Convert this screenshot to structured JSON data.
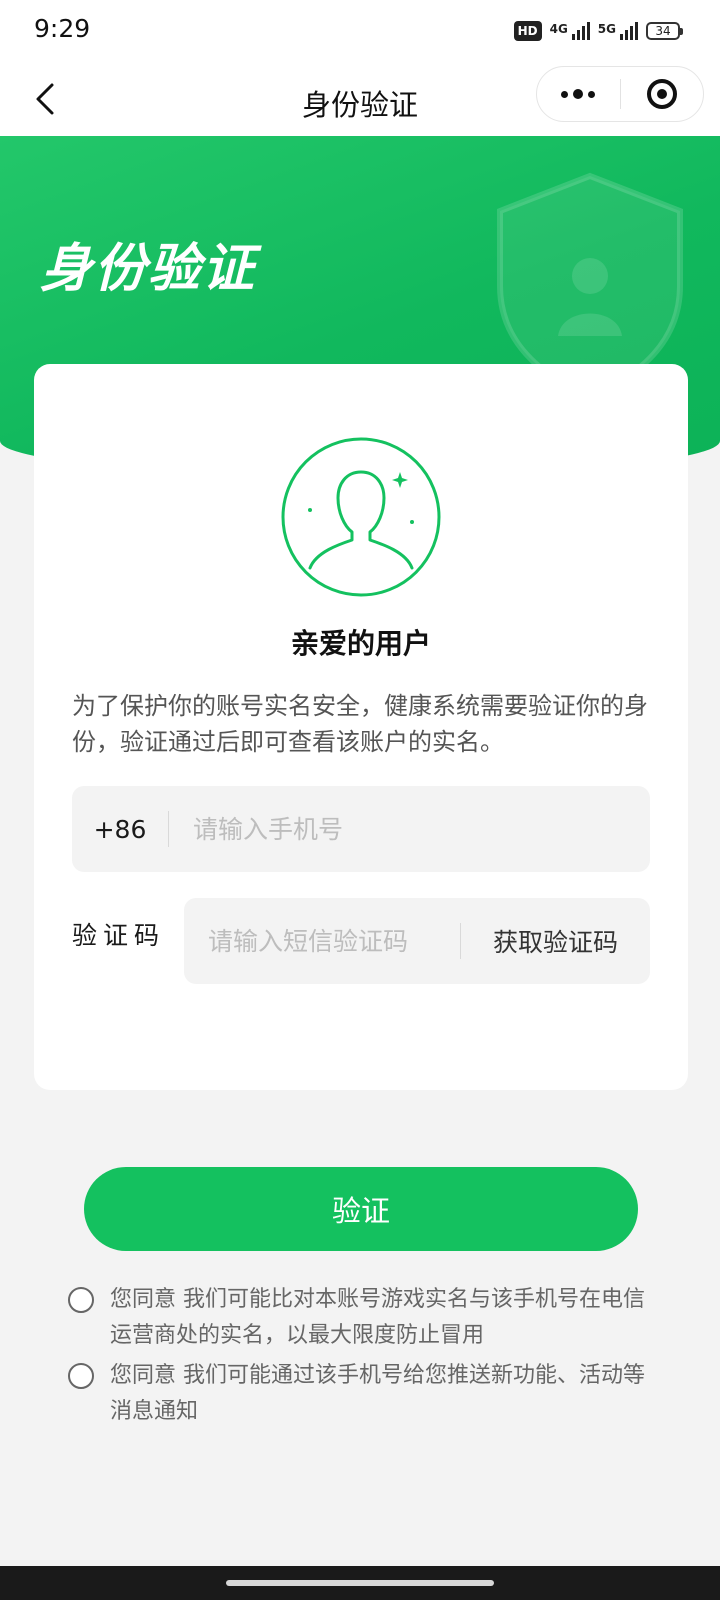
{
  "status_bar": {
    "time": "9:29",
    "hd_badge": "HD",
    "network_1": "4G",
    "network_2": "5G",
    "battery_level": "34"
  },
  "nav": {
    "title": "身份验证",
    "back_icon": "chevron-left-icon",
    "more_icon": "more-dots-icon",
    "close_icon": "target-close-icon"
  },
  "hero": {
    "title": "身份验证",
    "decoration_icon": "shield-user-icon"
  },
  "card": {
    "avatar_icon": "user-avatar-icon",
    "greeting": "亲爱的用户",
    "description": "为了保护你的账号实名安全，健康系统需要验证你的身份，验证通过后即可查看该账户的实名。",
    "phone": {
      "country_code": "+86",
      "placeholder": "请输入手机号",
      "value": ""
    },
    "code": {
      "label": "验证码",
      "placeholder": "请输入短信验证码",
      "value": "",
      "get_code_label": "获取验证码"
    }
  },
  "verify_button": "验证",
  "agreements": [
    {
      "text": "您同意 我们可能比对本账号游戏实名与该手机号在电信运营商处的实名，以最大限度防止冒用",
      "checked": false
    },
    {
      "text": "您同意 我们可能通过该手机号给您推送新功能、活动等消息通知",
      "checked": false
    }
  ],
  "colors": {
    "brand_green": "#14c15f",
    "page_bg": "#f3f3f3"
  }
}
